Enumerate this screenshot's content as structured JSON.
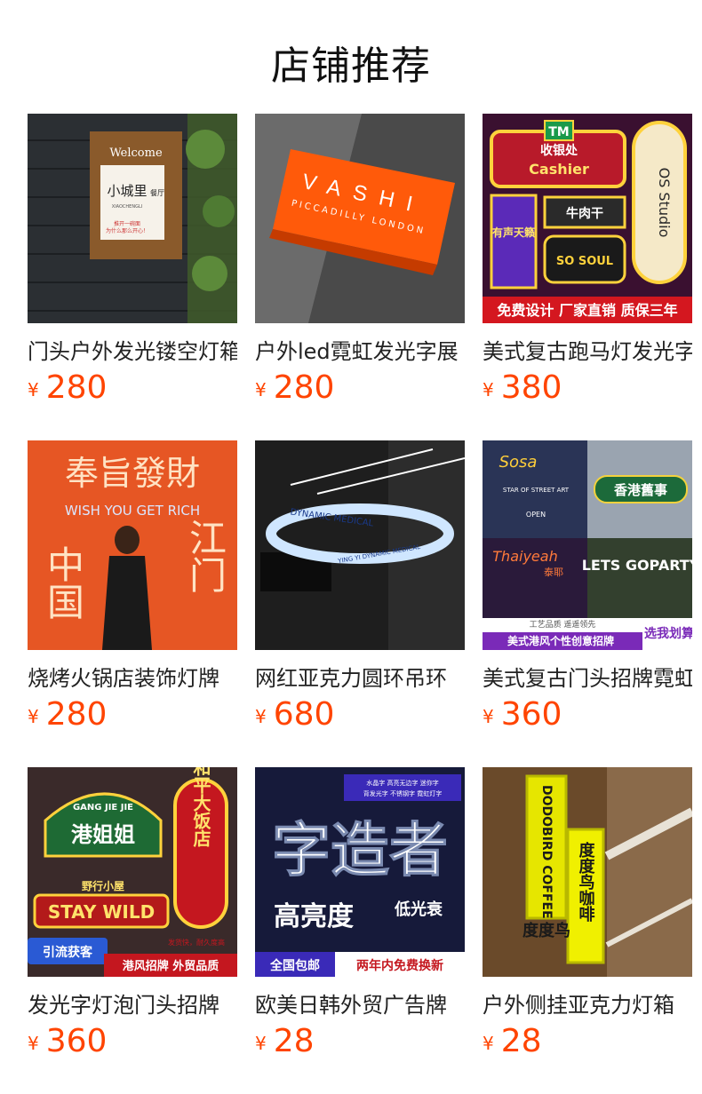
{
  "header": {
    "title": "店铺推荐"
  },
  "currency": "¥",
  "products": [
    {
      "title": "门头户外发光镂空灯箱",
      "price": "280",
      "image_text": [
        "Welcome",
        "小城里",
        "餐厅",
        "XIAOCHENGLI",
        "推开一碗面",
        "为什么那么开心！"
      ]
    },
    {
      "title": "户外led霓虹发光字展",
      "price": "280",
      "image_text": [
        "VASHI",
        "PICCADILLY LONDON"
      ]
    },
    {
      "title": "美式复古跑马灯发光字",
      "price": "380",
      "image_text": [
        "TM",
        "收银处",
        "Cashier",
        "OS Studio",
        "有声天籁",
        "牛肉干",
        "SO SOUL",
        "免费设计 厂家直销 质保三年"
      ]
    },
    {
      "title": "烧烤火锅店装饰灯牌",
      "price": "280",
      "image_text": [
        "奉旨發財",
        "WISH YOU GET RICH",
        "中国",
        "江门"
      ]
    },
    {
      "title": "网红亚克力圆环吊环",
      "price": "680",
      "image_text": [
        "DYNAMIC MEDICAL",
        "YING YI DYNAMIC MEDICAL"
      ]
    },
    {
      "title": "美式复古门头招牌霓虹",
      "price": "360",
      "image_text": [
        "Sosa",
        "STAR OF STREET ART",
        "OPEN",
        "香港舊事",
        "Thaiyeah",
        "泰耶",
        "LETS GOPARTY",
        "工艺品质 遥遥领先",
        "选我划算",
        "美式港风个性创意招牌"
      ]
    },
    {
      "title": "发光字灯泡门头招牌",
      "price": "360",
      "image_text": [
        "GANG JIE JIE",
        "港姐姐",
        "和平大饭店",
        "野行小屋",
        "STAY WILD",
        "发货快，耐久度高",
        "引流获客",
        "港风招牌 外贸品质"
      ]
    },
    {
      "title": "欧美日韩外贸广告牌",
      "price": "28",
      "image_text": [
        "水晶字 高亮无边字 迷你字",
        "背发光字 不锈钢字 霓虹灯字",
        "字造者",
        "高亮度",
        "低光衰",
        "全国包邮",
        "两年内免费换新"
      ]
    },
    {
      "title": "户外侧挂亚克力灯箱",
      "price": "28",
      "image_text": [
        "DODOBIRD COFFEE",
        "度度鸟咖啡",
        "度度鸟"
      ]
    }
  ]
}
